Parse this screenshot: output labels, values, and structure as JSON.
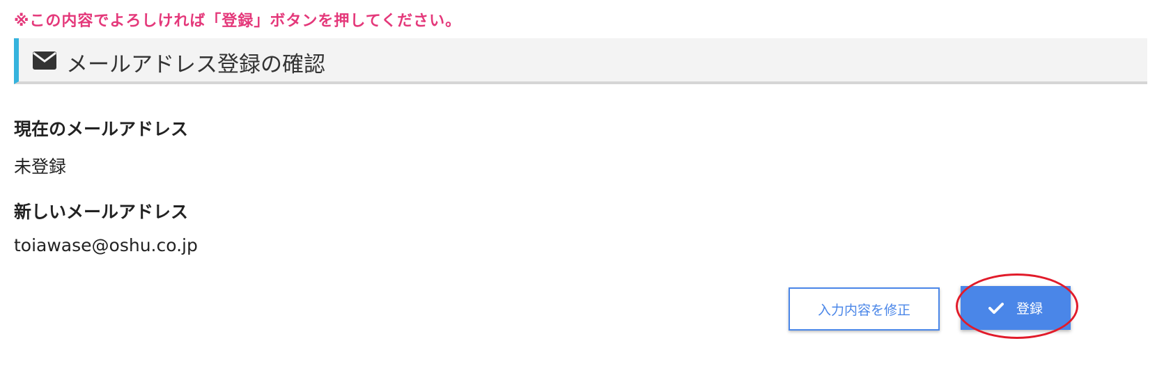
{
  "notice": "※この内容でよろしければ「登録」ボタンを押してください。",
  "section": {
    "icon": "envelope-icon",
    "title": "メールアドレス登録の確認",
    "accent_color": "#35b3dd"
  },
  "fields": [
    {
      "label": "現在のメールアドレス",
      "value": "未登録"
    },
    {
      "label": "新しいメールアドレス",
      "value": "toiawase@oshu.co.jp"
    }
  ],
  "buttons": {
    "edit_label": "入力内容を修正",
    "register_label": "登録",
    "register_icon": "check-icon",
    "primary_color": "#4a86e8"
  },
  "annotation": {
    "type": "highlight-circle",
    "color": "#e11b2a",
    "target": "register-button"
  }
}
